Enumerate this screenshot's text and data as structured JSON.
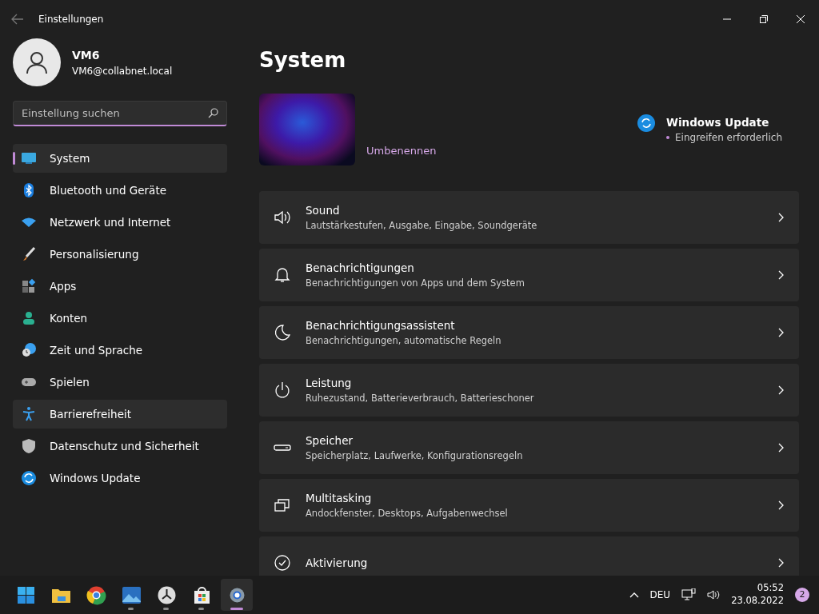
{
  "window": {
    "title": "Einstellungen"
  },
  "user": {
    "name": "VM6",
    "email": "VM6@collabnet.local"
  },
  "search": {
    "placeholder": "Einstellung suchen"
  },
  "sidebar": {
    "items": [
      {
        "label": "System",
        "selected": true,
        "hovered": false
      },
      {
        "label": "Bluetooth und Geräte",
        "selected": false,
        "hovered": false
      },
      {
        "label": "Netzwerk und Internet",
        "selected": false,
        "hovered": false
      },
      {
        "label": "Personalisierung",
        "selected": false,
        "hovered": false
      },
      {
        "label": "Apps",
        "selected": false,
        "hovered": false
      },
      {
        "label": "Konten",
        "selected": false,
        "hovered": false
      },
      {
        "label": "Zeit und Sprache",
        "selected": false,
        "hovered": false
      },
      {
        "label": "Spielen",
        "selected": false,
        "hovered": false
      },
      {
        "label": "Barrierefreiheit",
        "selected": false,
        "hovered": true
      },
      {
        "label": "Datenschutz und Sicherheit",
        "selected": false,
        "hovered": false
      },
      {
        "label": "Windows Update",
        "selected": false,
        "hovered": false
      }
    ]
  },
  "page": {
    "title": "System",
    "rename_link": "Umbenennen",
    "update": {
      "title": "Windows Update",
      "status": "Eingreifen erforderlich"
    },
    "cards": [
      {
        "title": "Sound",
        "subtitle": "Lautstärkestufen, Ausgabe, Eingabe, Soundgeräte"
      },
      {
        "title": "Benachrichtigungen",
        "subtitle": "Benachrichtigungen von Apps und dem System"
      },
      {
        "title": "Benachrichtigungsassistent",
        "subtitle": "Benachrichtigungen, automatische Regeln"
      },
      {
        "title": "Leistung",
        "subtitle": "Ruhezustand, Batterieverbrauch, Batterieschoner"
      },
      {
        "title": "Speicher",
        "subtitle": "Speicherplatz, Laufwerke, Konfigurationsregeln"
      },
      {
        "title": "Multitasking",
        "subtitle": "Andockfenster, Desktops, Aufgabenwechsel"
      },
      {
        "title": "Aktivierung"
      }
    ]
  },
  "taskbar": {
    "apps": [
      {
        "running": false,
        "active": false
      },
      {
        "running": false,
        "active": false
      },
      {
        "running": false,
        "active": false
      },
      {
        "running": true,
        "active": false
      },
      {
        "running": true,
        "active": false
      },
      {
        "running": true,
        "active": false
      },
      {
        "running": true,
        "active": true
      }
    ],
    "language": "DEU",
    "time": "05:52",
    "date": "23.08.2022",
    "notifications": "2"
  }
}
